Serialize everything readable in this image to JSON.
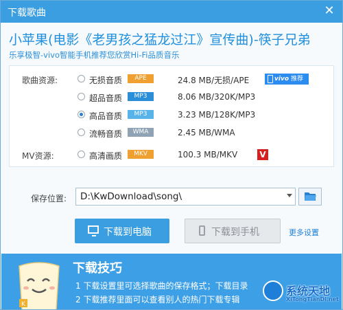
{
  "window": {
    "title": "下载歌曲",
    "close_glyph": "✕"
  },
  "song": {
    "title": "小苹果(电影《老男孩之猛龙过江》宣传曲)-筷子兄弟",
    "subtitle": "乐享极智-vivo智能手机推荐您欣赏Hi-Fi品质音乐"
  },
  "resources": {
    "song_label": "歌曲资源:",
    "mv_label": "MV资源:",
    "options": [
      {
        "name": "无损音质",
        "format": "APE",
        "size": "24.8 MB/无损/APE",
        "selected": false,
        "badge_color": "#f0a030"
      },
      {
        "name": "超品音质",
        "format": "MP3",
        "size": "8.06 MB/320K/MP3",
        "selected": false,
        "badge_color": "#2a8fd8"
      },
      {
        "name": "高品音质",
        "format": "MP3",
        "size": "3.23 MB/128K/MP3",
        "selected": true,
        "badge_color": "#58b4e8"
      },
      {
        "name": "流畅音质",
        "format": "WMA",
        "size": "2.45 MB/WMA",
        "selected": false,
        "badge_color": "#8fa3b5"
      },
      {
        "name": "高清画质",
        "format": "MKV",
        "size": "100.3 MB/MKV",
        "selected": false,
        "badge_color": "#f0a030"
      }
    ],
    "vivo_badge": {
      "brand": "vivo",
      "text": "推荐"
    },
    "v_flag": "V"
  },
  "save": {
    "label": "保存位置:",
    "path": "D:\\KwDownload\\song\\"
  },
  "buttons": {
    "download_pc": "下载到电脑",
    "download_phone": "下载到手机",
    "more_settings": "更多设置"
  },
  "tips": {
    "heading": "下载技巧",
    "lines": [
      "1 下载设置里可选择歌曲的保存格式；下载目录",
      "2 下载推荐里面可以查看别人的热门下载专辑"
    ]
  },
  "watermark": {
    "name": "系统天地",
    "url": "XiTongTianDi.net"
  },
  "colors": {
    "accent": "#3b9ee0",
    "title_blue": "#1f8fde",
    "tips_bg": "#3d9fe6"
  }
}
